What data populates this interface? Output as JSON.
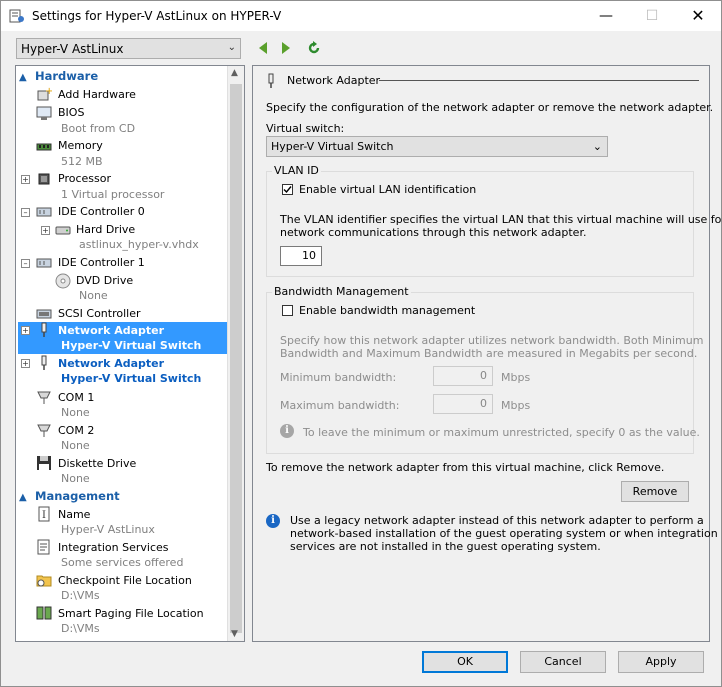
{
  "window": {
    "title": "Settings for Hyper-V AstLinux on HYPER-V"
  },
  "vm_selector": {
    "value": "Hyper-V AstLinux"
  },
  "tree": {
    "hardware_label": "Hardware",
    "management_label": "Management",
    "items": {
      "add_hardware": "Add Hardware",
      "bios": "BIOS",
      "bios_sub": "Boot from CD",
      "memory": "Memory",
      "memory_sub": "512 MB",
      "processor": "Processor",
      "processor_sub": "1 Virtual processor",
      "ide0": "IDE Controller 0",
      "hard_drive": "Hard Drive",
      "hard_drive_sub": "astlinux_hyper-v.vhdx",
      "ide1": "IDE Controller 1",
      "dvd": "DVD Drive",
      "dvd_sub": "None",
      "scsi": "SCSI Controller",
      "net1": "Network Adapter",
      "net1_sub": "Hyper-V Virtual Switch",
      "net2": "Network Adapter",
      "net2_sub": "Hyper-V Virtual Switch",
      "com1": "COM 1",
      "com1_sub": "None",
      "com2": "COM 2",
      "com2_sub": "None",
      "diskette": "Diskette Drive",
      "diskette_sub": "None",
      "name": "Name",
      "name_sub": "Hyper-V AstLinux",
      "integration": "Integration Services",
      "integration_sub": "Some services offered",
      "checkpoint": "Checkpoint File Location",
      "checkpoint_sub": "D:\\VMs",
      "smart_paging": "Smart Paging File Location",
      "smart_paging_sub": "D:\\VMs"
    }
  },
  "panel": {
    "title": "Network Adapter",
    "description": "Specify the configuration of the network adapter or remove the network adapter.",
    "virtual_switch_label": "Virtual switch:",
    "virtual_switch_value": "Hyper-V Virtual Switch",
    "vlan": {
      "title": "VLAN ID",
      "checkbox_label": "Enable virtual LAN identification",
      "checked": true,
      "help_line1": "The VLAN identifier specifies the virtual LAN that this virtual machine will use for all",
      "help_line2": "network communications through this network adapter.",
      "value": "10"
    },
    "bandwidth": {
      "title": "Bandwidth Management",
      "checkbox_label": "Enable bandwidth management",
      "checked": false,
      "help_line1": "Specify how this network adapter utilizes network bandwidth. Both Minimum",
      "help_line2": "Bandwidth and Maximum Bandwidth are measured in Megabits per second.",
      "min_label": "Minimum bandwidth:",
      "min_value": "0",
      "max_label": "Maximum bandwidth:",
      "max_value": "0",
      "unit": "Mbps",
      "info": "To leave the minimum or maximum unrestricted, specify 0 as the value."
    },
    "remove_text": "To remove the network adapter from this virtual machine, click Remove.",
    "remove_button": "Remove",
    "legacy_line1": "Use a legacy network adapter instead of this network adapter to perform a",
    "legacy_line2": "network-based installation of the guest operating system or when integration",
    "legacy_line3": "services are not installed in the guest operating system."
  },
  "buttons": {
    "ok": "OK",
    "cancel": "Cancel",
    "apply": "Apply"
  }
}
